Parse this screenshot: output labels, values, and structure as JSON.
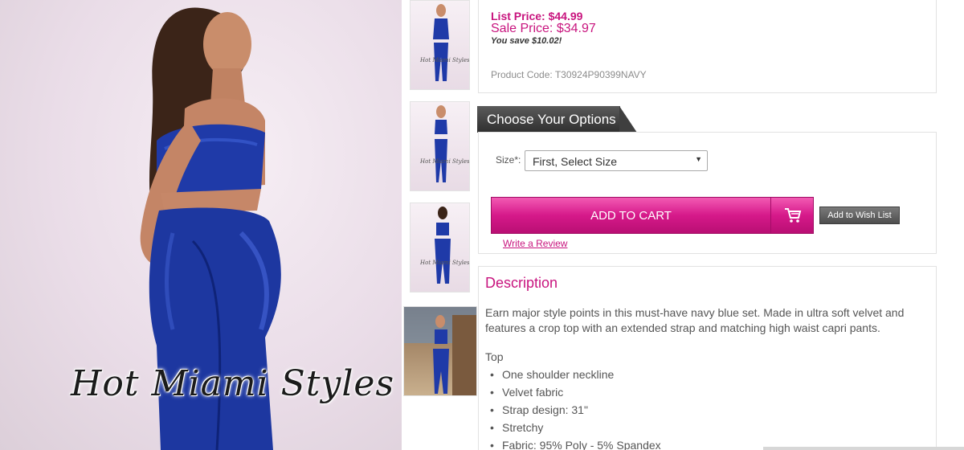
{
  "gallery": {
    "watermark": "Hot Miami Styles",
    "thumbnails": [
      "Hot Miami Styles",
      "Hot Miami Styles",
      "Hot Miami Styles",
      ""
    ]
  },
  "pricing": {
    "list_price": "List Price: $44.99",
    "sale_price": "Sale Price: $34.97",
    "you_save": "You save $10.02!",
    "product_code": "Product Code: T30924P90399NAVY"
  },
  "options": {
    "tab_title": "Choose Your Options",
    "size_label": "Size*:",
    "size_selected": "First, Select Size",
    "caret_icon": "▼",
    "add_to_cart": "ADD TO CART",
    "cart_icon": "shopping-cart-icon",
    "wish_list": "Add to Wish List",
    "review_link": "Write a Review"
  },
  "description": {
    "title": "Description",
    "body": "Earn major style points in this must-have navy blue set. Made in ultra soft velvet and features a crop top with an extended strap and matching high waist capri pants.",
    "section": "Top",
    "bullet": "•",
    "features": [
      "One shoulder neckline",
      "Velvet fabric",
      "Strap design: 31\"",
      "Stretchy",
      "Fabric: 95% Poly - 5% Spandex"
    ]
  },
  "colors": {
    "accent": "#c8147e",
    "velvet_blue": "#1f3aa8",
    "cart_gradient_top": "#f25ab3",
    "cart_gradient_bottom": "#b90f74"
  }
}
